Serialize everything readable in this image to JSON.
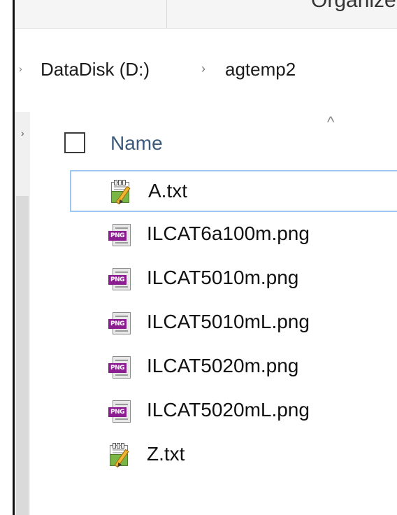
{
  "ribbon": {
    "organize_label": "Organize"
  },
  "address": {
    "drive": "DataDisk (D:)",
    "folder": "agtemp2",
    "separator": "›"
  },
  "header": {
    "name_label": "Name",
    "sort_glyph": "^"
  },
  "files": [
    {
      "name": "A.txt",
      "type": "txt",
      "focused": true
    },
    {
      "name": "ILCAT6a100m.png",
      "type": "png"
    },
    {
      "name": "ILCAT5010m.png",
      "type": "png"
    },
    {
      "name": "ILCAT5010mL.png",
      "type": "png"
    },
    {
      "name": "ILCAT5020m.png",
      "type": "png"
    },
    {
      "name": "ILCAT5020mL.png",
      "type": "png"
    },
    {
      "name": "Z.txt",
      "type": "txt"
    }
  ],
  "icons": {
    "png_badge": "PNG"
  },
  "colors": {
    "png_badge": "#8b1d91",
    "focus_border": "#9dc7ee",
    "header_text": "#3d5a7d"
  }
}
